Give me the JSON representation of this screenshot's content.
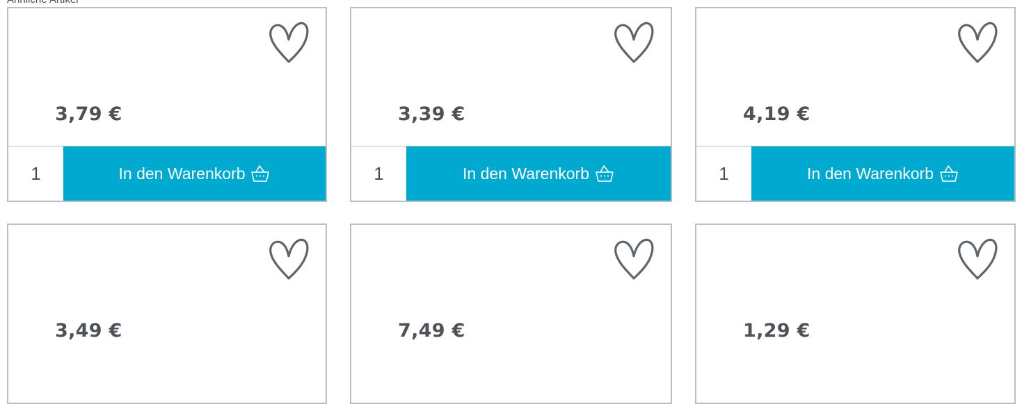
{
  "top_text": "Ähnliche Artikel",
  "cart_label": "In den Warenkorb",
  "products": [
    {
      "price": "3,79 €",
      "quantity": "1"
    },
    {
      "price": "3,39 €",
      "quantity": "1"
    },
    {
      "price": "4,19 €",
      "quantity": "1"
    },
    {
      "price": "3,49 €"
    },
    {
      "price": "7,49 €"
    },
    {
      "price": "1,29 €"
    }
  ],
  "colors": {
    "accent": "#00a9d0",
    "border": "#b9bfc6",
    "text": "#4d5258",
    "heart_stroke": "#5e656c"
  },
  "icons": {
    "favorite": "heart-outline-icon",
    "cart": "basket-icon"
  }
}
